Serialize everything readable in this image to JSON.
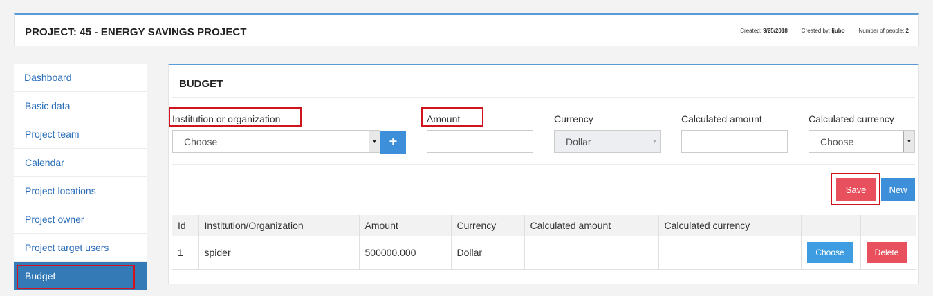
{
  "header": {
    "title": "PROJECT: 45 - ENERGY SAVINGS PROJECT",
    "created_label": "Created:",
    "created_value": "9/25/2018",
    "created_by_label": "Created by:",
    "created_by_value": "ljubo",
    "people_label": "Number of people:",
    "people_value": "2"
  },
  "sidebar": {
    "items": [
      {
        "label": "Dashboard"
      },
      {
        "label": "Basic data"
      },
      {
        "label": "Project team"
      },
      {
        "label": "Calendar"
      },
      {
        "label": "Project locations"
      },
      {
        "label": "Project owner"
      },
      {
        "label": "Project target users"
      },
      {
        "label": "Budget",
        "active": true
      }
    ]
  },
  "budget": {
    "title": "BUDGET",
    "form": {
      "institution_label": "Institution or organization",
      "institution_value": "Choose",
      "add_icon": "plus-icon",
      "amount_label": "Amount",
      "amount_value": "",
      "currency_label": "Currency",
      "currency_value": "Dollar",
      "calc_amount_label": "Calculated amount",
      "calc_amount_value": "",
      "calc_currency_label": "Calculated currency",
      "calc_currency_value": "Choose"
    },
    "actions": {
      "save_label": "Save",
      "new_label": "New"
    },
    "table": {
      "columns": [
        "Id",
        "Institution/Organization",
        "Amount",
        "Currency",
        "Calculated amount",
        "Calculated currency",
        "",
        ""
      ],
      "rows": [
        {
          "id": "1",
          "institution": "spider",
          "amount": "500000.000",
          "currency": "Dollar",
          "calc_amount": "",
          "calc_currency": "",
          "choose_label": "Choose",
          "delete_label": "Delete"
        }
      ]
    }
  },
  "colors": {
    "accent": "#337ab7",
    "primary_button": "#3d8fd9",
    "danger_button": "#e8505e",
    "highlight_box": "#d0141f"
  }
}
